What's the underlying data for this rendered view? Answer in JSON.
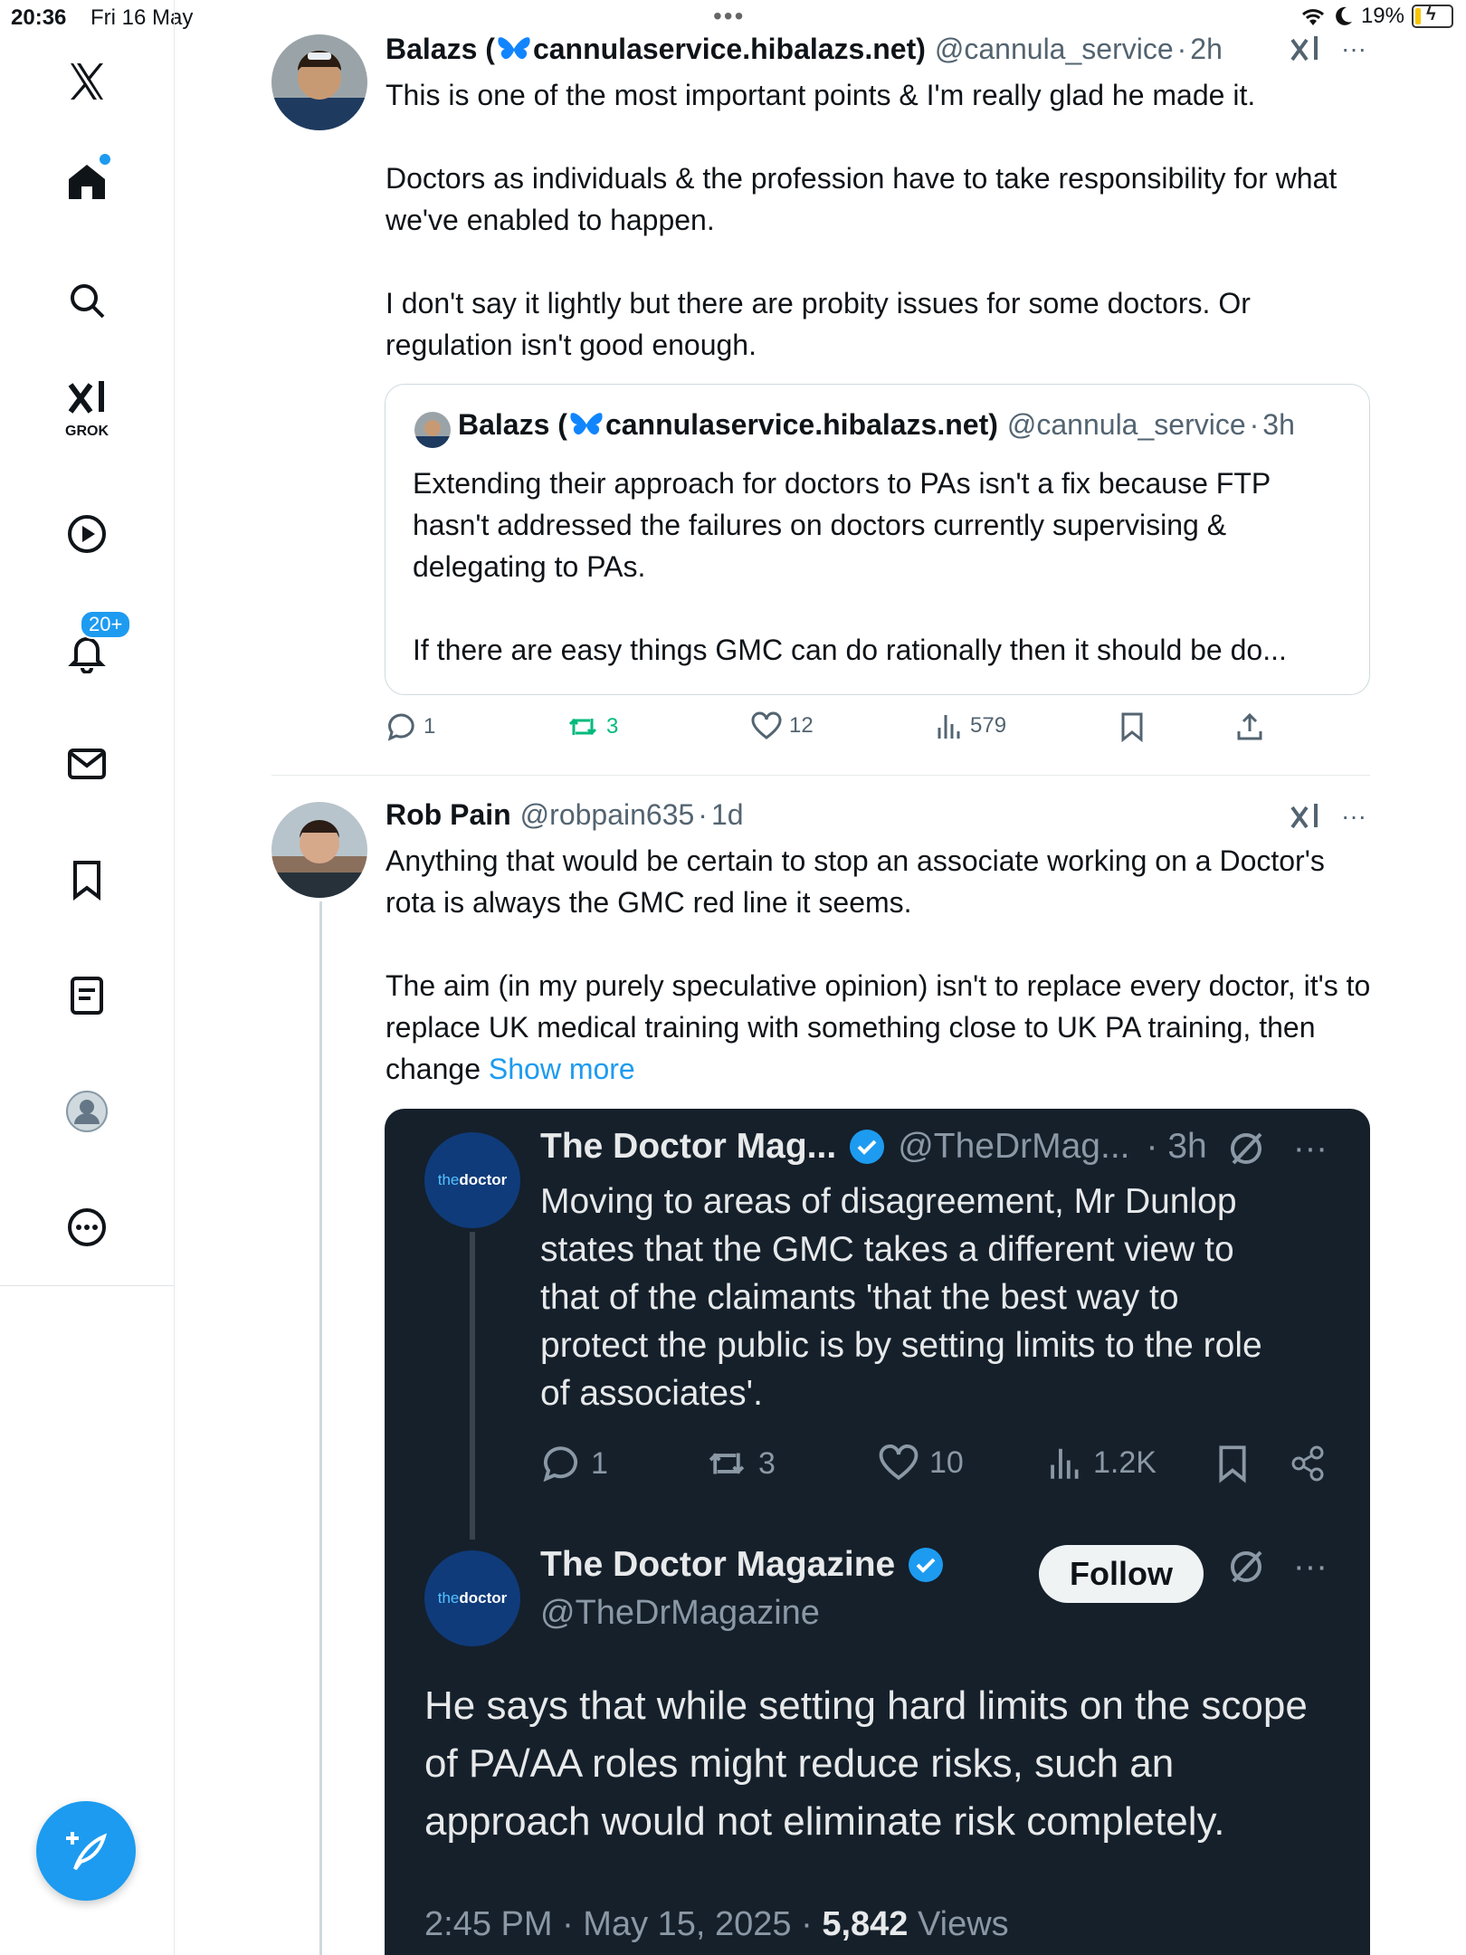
{
  "status_bar": {
    "time": "20:36",
    "date": "Fri 16 May",
    "battery": "19%",
    "battery_level": 0.19
  },
  "sidebar": {
    "grok_label": "GROK",
    "notifications_badge": "20+"
  },
  "tweet1": {
    "name": "Balazs (",
    "name_domain": "cannulaservice.hibalazs.net)",
    "handle": "@cannula_service",
    "separator": "·",
    "time": "2h",
    "text": "This is one of the most important points & I'm really glad he made it.\n\nDoctors as individuals & the profession have to take responsibility for what we've enabled to happen.\n\nI don't say it lightly but there are probity issues for some doctors. Or regulation isn't good enough.",
    "quote": {
      "name": "Balazs (",
      "name_domain": "cannulaservice.hibalazs.net)",
      "handle": "@cannula_service",
      "separator": "·",
      "time": "3h",
      "text": "Extending their approach for doctors to PAs isn't a fix because FTP hasn't addressed the failures on doctors currently supervising & delegating to PAs.\n\nIf there are easy things GMC can do rationally then it should be do..."
    },
    "replies": "1",
    "reposts": "3",
    "likes": "12",
    "views": "579"
  },
  "tweet2": {
    "name": "Rob Pain",
    "handle": "@robpain635",
    "separator": "·",
    "time": "1d",
    "text": "Anything that would be certain to stop an associate working on a Doctor's rota is always the GMC red line it seems.\n\nThe aim (in my purely speculative opinion) isn't to replace every doctor, it's to replace UK medical training with something close to UK PA training, then change ",
    "show_more": "Show more",
    "media": {
      "logo_a": "the",
      "logo_b": "doctor",
      "post1": {
        "name": "The Doctor Mag...",
        "handle": "@TheDrMag...",
        "time": "· 3h",
        "text": "Moving to areas of disagreement, Mr Dunlop\nstates that the GMC takes a different view to\nthat of the claimants 'that the best way to\nprotect the public is by setting limits to the role\nof associates'.",
        "replies": "1",
        "reposts": "3",
        "likes": "10",
        "views": "1.2K"
      },
      "post2": {
        "name": "The Doctor Magazine",
        "handle": "@TheDrMagazine",
        "follow": "Follow",
        "text": "He says that while setting hard limits on the scope of PA/AA roles might reduce risks, such an approach would not eliminate risk completely.",
        "timestamp": "2:45 PM · May 15, 2025 · ",
        "views_count": "5,842",
        "views_label": " Views"
      }
    }
  }
}
